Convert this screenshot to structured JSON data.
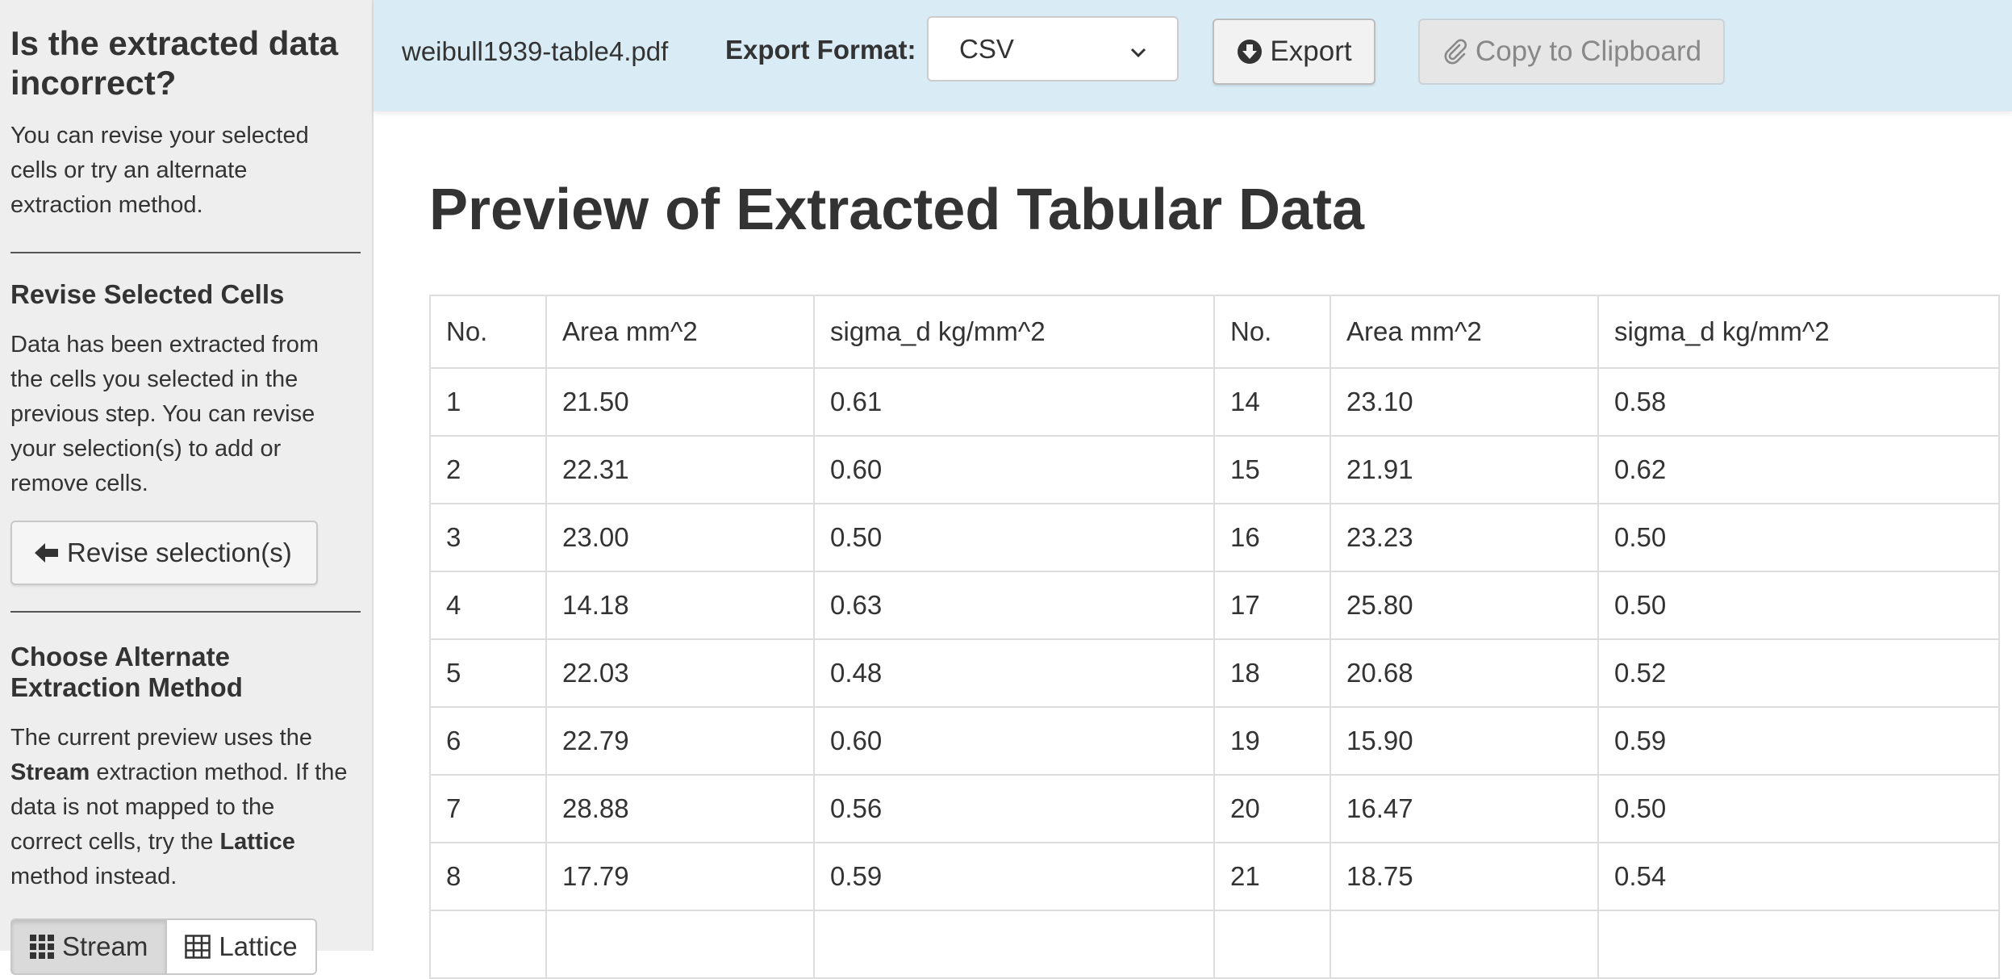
{
  "sidebar": {
    "heading": "Is the extracted data incorrect?",
    "intro": "You can revise your selected cells or try an alternate extraction method.",
    "revise_heading": "Revise Selected Cells",
    "revise_text": "Data has been extracted from the cells you selected in the previous step. You can revise your selection(s) to add or remove cells.",
    "revise_button": "Revise selection(s)",
    "alt_heading": "Choose Alternate Extraction Method",
    "alt_text": {
      "p1": "The current preview uses the ",
      "stream_word": "Stream",
      "p2": " extraction method. If the data is not mapped to the correct cells, try the ",
      "lattice_word": "Lattice",
      "p3": " method instead."
    },
    "methods": {
      "stream": "Stream",
      "lattice": "Lattice"
    }
  },
  "topbar": {
    "filename": "weibull1939-table4.pdf",
    "format_label": "Export Format:",
    "format_value": "CSV",
    "export_label": "Export",
    "copy_label": "Copy to Clipboard"
  },
  "main": {
    "title": "Preview of Extracted Tabular Data",
    "columns": [
      "No.",
      "Area mm^2",
      "sigma_d kg/mm^2",
      "No.",
      "Area mm^2",
      "sigma_d kg/mm^2"
    ],
    "rows": [
      [
        "1",
        "21.50",
        "0.61",
        "14",
        "23.10",
        "0.58"
      ],
      [
        "2",
        "22.31",
        "0.60",
        "15",
        "21.91",
        "0.62"
      ],
      [
        "3",
        "23.00",
        "0.50",
        "16",
        "23.23",
        "0.50"
      ],
      [
        "4",
        "14.18",
        "0.63",
        "17",
        "25.80",
        "0.50"
      ],
      [
        "5",
        "22.03",
        "0.48",
        "18",
        "20.68",
        "0.52"
      ],
      [
        "6",
        "22.79",
        "0.60",
        "19",
        "15.90",
        "0.59"
      ],
      [
        "7",
        "28.88",
        "0.56",
        "20",
        "16.47",
        "0.50"
      ],
      [
        "8",
        "17.79",
        "0.59",
        "21",
        "18.75",
        "0.54"
      ],
      [
        "",
        "",
        "",
        "",
        "",
        ""
      ]
    ]
  },
  "icons": {
    "revise": "arrow-left-icon",
    "stream": "th-icon",
    "lattice": "grid-icon",
    "export": "download-circle-icon",
    "copy": "paperclip-icon",
    "select": "chevron-down-icon"
  },
  "colors": {
    "topbar_bg": "#d9ecf6",
    "sidebar_bg": "#eeeeee",
    "text": "#333333"
  }
}
